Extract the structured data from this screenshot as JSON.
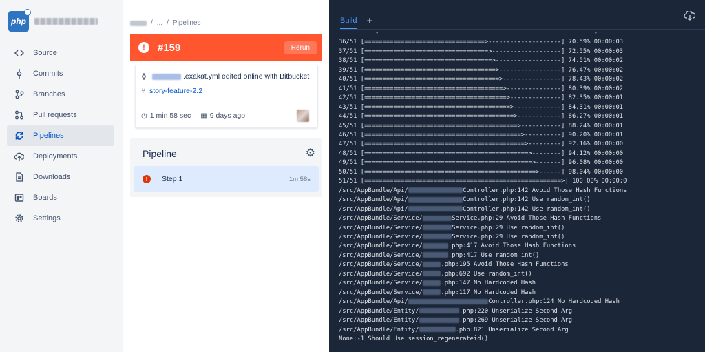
{
  "sidebar": {
    "repo_logo": "php",
    "items": [
      {
        "label": "Source",
        "icon": "code-icon",
        "active": false
      },
      {
        "label": "Commits",
        "icon": "commit-icon",
        "active": false
      },
      {
        "label": "Branches",
        "icon": "branch-icon",
        "active": false
      },
      {
        "label": "Pull requests",
        "icon": "pull-request-icon",
        "active": false
      },
      {
        "label": "Pipelines",
        "icon": "pipelines-icon",
        "active": true
      },
      {
        "label": "Deployments",
        "icon": "cloud-upload-icon",
        "active": false
      },
      {
        "label": "Downloads",
        "icon": "file-icon",
        "active": false
      },
      {
        "label": "Boards",
        "icon": "board-icon",
        "active": false
      },
      {
        "label": "Settings",
        "icon": "gear-icon",
        "active": false
      }
    ]
  },
  "breadcrumb": {
    "sep": "/",
    "ellipsis": "...",
    "current": "Pipelines"
  },
  "banner": {
    "number": "#159",
    "rerun_label": "Rerun",
    "color": "#ff5630"
  },
  "commit": {
    "message": ".exakat.yml edited online with Bitbucket",
    "branch": "story-feature-2.2",
    "duration": "1 min 58 sec",
    "age": "9 days ago"
  },
  "pipeline": {
    "title": "Pipeline",
    "steps": [
      {
        "name": "Step 1",
        "time": "1m 58s",
        "status": "failed"
      }
    ]
  },
  "terminal": {
    "tab_label": "Build",
    "add_label": "+",
    "background": "#1b2638",
    "accent": "#4c9aff",
    "progress_top": "          -                                                           -",
    "progress": [
      [
        "36/51",
        33,
        20,
        "70.59% 00:00:03"
      ],
      [
        "37/51",
        34,
        19,
        "72.55% 00:00:03"
      ],
      [
        "38/51",
        35,
        18,
        "74.51% 00:00:02"
      ],
      [
        "39/51",
        36,
        17,
        "76.47% 00:00:02"
      ],
      [
        "40/51",
        37,
        16,
        "78.43% 00:00:02"
      ],
      [
        "41/51",
        38,
        15,
        "80.39% 00:00:02"
      ],
      [
        "42/51",
        39,
        14,
        "82.35% 00:00:01"
      ],
      [
        "43/51",
        40,
        13,
        "84.31% 00:00:01"
      ],
      [
        "44/51",
        41,
        12,
        "86.27% 00:00:01"
      ],
      [
        "45/51",
        42,
        11,
        "88.24% 00:00:01"
      ],
      [
        "46/51",
        43,
        10,
        "90.20% 00:00:01"
      ],
      [
        "47/51",
        44,
        9,
        "92.16% 00:00:00"
      ],
      [
        "48/51",
        45,
        8,
        "94.12% 00:00:00"
      ],
      [
        "49/51",
        46,
        7,
        "96.08% 00:00:00"
      ],
      [
        "50/51",
        47,
        6,
        "98.04% 00:00:00"
      ],
      [
        "51/51",
        54,
        0,
        "100.00% 00:00:0"
      ]
    ],
    "results": [
      {
        "prefix": "/src/AppBundle/Api/",
        "blur": 15,
        "suffix": "Controller.php:142 Avoid Those Hash Functions"
      },
      {
        "prefix": "/src/AppBundle/Api/",
        "blur": 15,
        "suffix": "Controller.php:142 Use random_int()"
      },
      {
        "prefix": "/src/AppBundle/Api/",
        "blur": 15,
        "suffix": "Controller.php:142 Use random_int()"
      },
      {
        "prefix": "/src/AppBundle/Service/",
        "blur": 8,
        "suffix": "Service.php:29 Avoid Those Hash Functions"
      },
      {
        "prefix": "/src/AppBundle/Service/",
        "blur": 8,
        "suffix": "Service.php:29 Use random_int()"
      },
      {
        "prefix": "/src/AppBundle/Service/",
        "blur": 8,
        "suffix": "Service.php:29 Use random_int()"
      },
      {
        "prefix": "/src/AppBundle/Service/",
        "blur": 7,
        "suffix": ".php:417 Avoid Those Hash Functions"
      },
      {
        "prefix": "/src/AppBundle/Service/",
        "blur": 7,
        "suffix": ".php:417 Use random_int()"
      },
      {
        "prefix": "/src/AppBundle/Service/",
        "blur": 5,
        "suffix": ".php:195 Avoid Those Hash Functions"
      },
      {
        "prefix": "/src/AppBundle/Service/",
        "blur": 5,
        "suffix": ".php:692 Use random_int()"
      },
      {
        "prefix": "/src/AppBundle/Service/",
        "blur": 5,
        "suffix": ".php:147 No Hardcoded Hash"
      },
      {
        "prefix": "/src/AppBundle/Service/",
        "blur": 5,
        "suffix": ".php:117 No Hardcoded Hash"
      },
      {
        "prefix": "/src/AppBundle/Api/",
        "blur": 22,
        "suffix": "Controller.php:124 No Hardcoded Hash"
      },
      {
        "prefix": "/src/AppBundle/Entity/",
        "blur": 11,
        "suffix": ".php:220 Unserialize Second Arg"
      },
      {
        "prefix": "/src/AppBundle/Entity/",
        "blur": 11,
        "suffix": ".php:269 Unserialize Second Arg"
      },
      {
        "prefix": "/src/AppBundle/Entity/",
        "blur": 10,
        "suffix": ".php:821 Unserialize Second Arg"
      },
      {
        "prefix": "None:-1 Should Use session_regenerateid()",
        "blur": 0,
        "suffix": ""
      }
    ]
  }
}
